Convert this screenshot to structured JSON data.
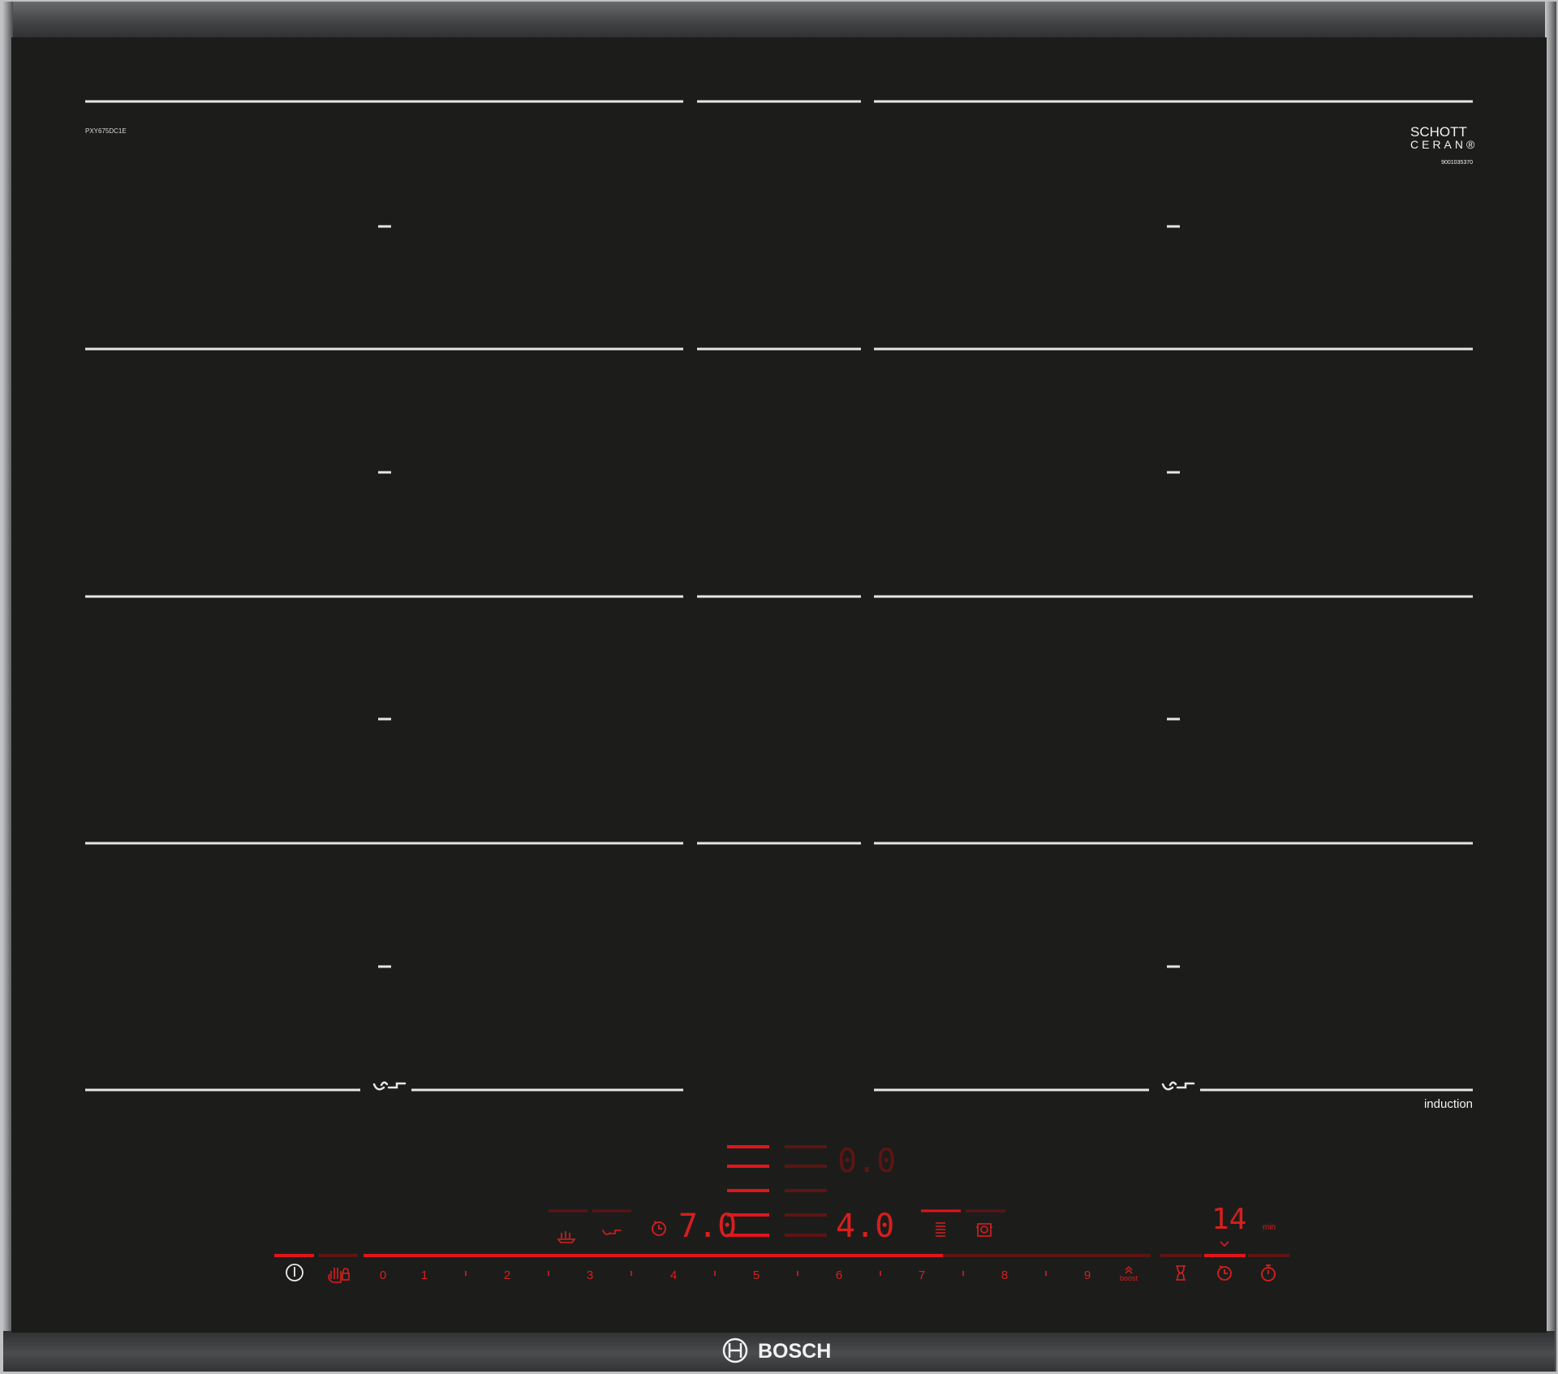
{
  "device": {
    "model_code": "PXY675DC1E",
    "glass_brand_line1": "SCHOTT",
    "glass_brand_line2": "CERAN®",
    "glass_serial": "9001035370",
    "induction_label": "induction",
    "brand": "BOSCH"
  },
  "colors": {
    "glass": "#1c1d1b",
    "frame": "#3a3b3d",
    "zone_line": "#e6e6e6",
    "led_bright": "#e3141a",
    "led_dim": "#5e1414",
    "led_text": "#d81e1e"
  },
  "display": {
    "upper_readout": "0.0",
    "left_zone_power": "7.0",
    "right_zone_power": "4.0",
    "timer_value": "14",
    "timer_unit": "min"
  },
  "power_scale": {
    "labels": [
      "0",
      "1",
      "2",
      "3",
      "4",
      "5",
      "6",
      "7",
      "8",
      "9"
    ],
    "boost_label": "boost",
    "active_level": 7
  },
  "icons": {
    "power": "power-icon",
    "child_lock": "hand-lock-icon",
    "keep_warm": "keep-warm-icon",
    "flex_zone": "flexinduction-icon",
    "zone_timer": "zone-timer-icon",
    "pan_boost": "pan-boost-icon",
    "power_manager": "power-manager-icon",
    "egg_timer": "hourglass-icon",
    "timer_clock": "timer-clock-icon",
    "stopwatch": "stopwatch-icon"
  }
}
